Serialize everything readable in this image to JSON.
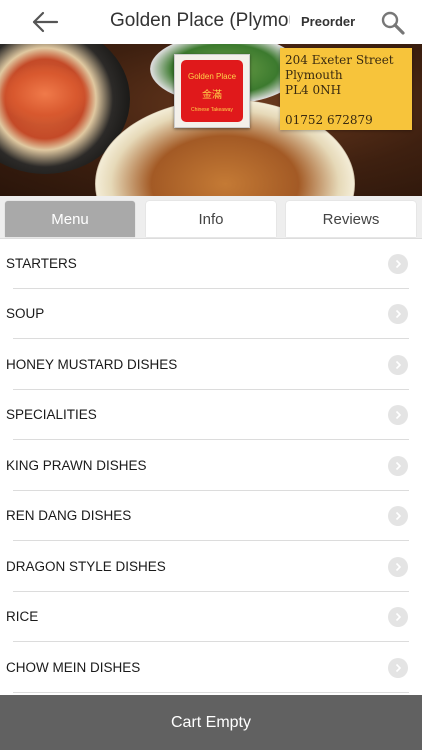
{
  "header": {
    "title": "Golden Place (Plymouth)",
    "preorder_label": "Preorder",
    "back_icon": "back-arrow-icon",
    "search_icon": "search-icon"
  },
  "banner": {
    "logo": {
      "name": "Golden Place",
      "chinese": "金滿",
      "subtitle": "Chinese Takeaway"
    },
    "address": {
      "line1": "204 Exeter Street",
      "line2": "Plymouth",
      "line3": "PL4 0NH",
      "phone": "01752  672879"
    }
  },
  "tabs": [
    {
      "label": "Menu",
      "active": true
    },
    {
      "label": "Info",
      "active": false
    },
    {
      "label": "Reviews",
      "active": false
    }
  ],
  "menu_categories": [
    {
      "label": "STARTERS"
    },
    {
      "label": "SOUP"
    },
    {
      "label": "HONEY MUSTARD DISHES"
    },
    {
      "label": "SPECIALITIES"
    },
    {
      "label": "KING PRAWN DISHES"
    },
    {
      "label": "REN DANG DISHES"
    },
    {
      "label": "DRAGON STYLE DISHES"
    },
    {
      "label": "RICE"
    },
    {
      "label": "CHOW MEIN DISHES"
    }
  ],
  "cart": {
    "label": "Cart Empty"
  },
  "colors": {
    "active_tab": "#a9a9a9",
    "cart_bar": "#616161",
    "address_card": "#f7c43b",
    "logo_red": "#e0191b"
  }
}
